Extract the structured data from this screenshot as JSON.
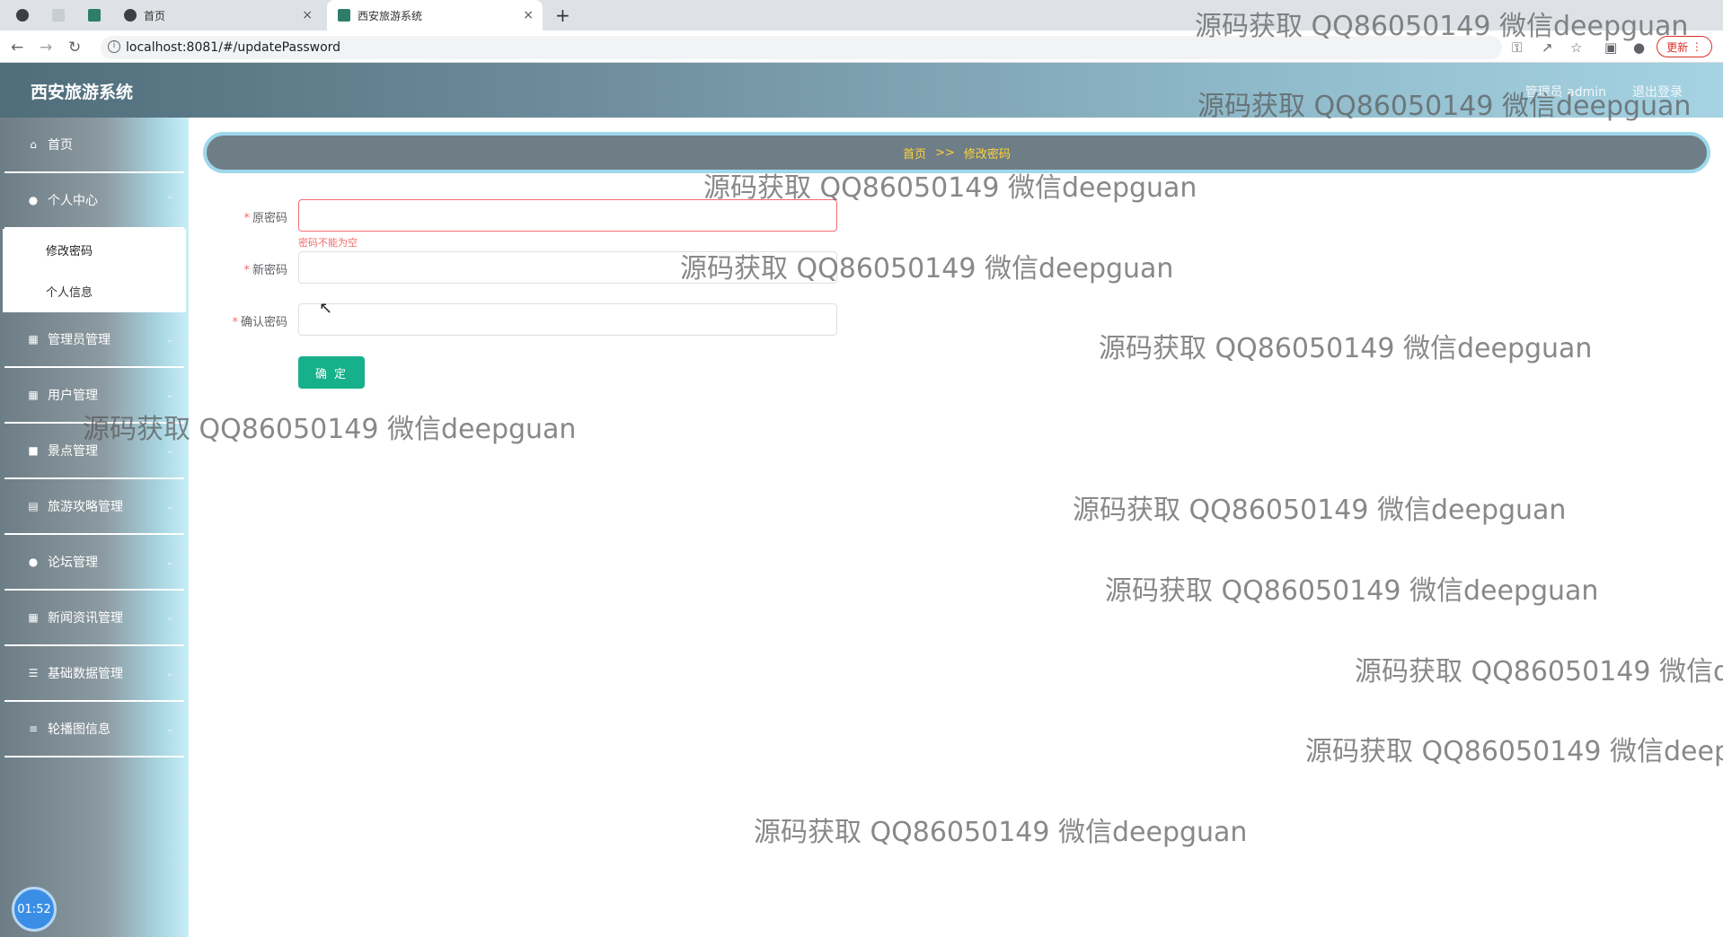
{
  "browser": {
    "tabs": [
      {
        "title": "首页"
      },
      {
        "title": "西安旅游系统"
      }
    ],
    "new_tab": "+",
    "close": "×",
    "url": "localhost:8081/#/updatePassword",
    "update_label": "更新"
  },
  "header": {
    "title": "西安旅游系统",
    "user": "管理员 admin",
    "logout": "退出登录"
  },
  "sidebar": {
    "items": [
      {
        "label": "首页",
        "icon": "home-icon"
      },
      {
        "label": "个人中心",
        "icon": "user-icon"
      },
      {
        "label": "管理员管理",
        "icon": "grid-icon"
      },
      {
        "label": "用户管理",
        "icon": "grid-icon"
      },
      {
        "label": "景点管理",
        "icon": "comment-icon"
      },
      {
        "label": "旅游攻略管理",
        "icon": "document-icon"
      },
      {
        "label": "论坛管理",
        "icon": "user-icon"
      },
      {
        "label": "新闻资讯管理",
        "icon": "grid-icon"
      },
      {
        "label": "基础数据管理",
        "icon": "stack-icon"
      },
      {
        "label": "轮播图信息",
        "icon": "menu-icon"
      }
    ],
    "submenu": [
      {
        "label": "修改密码"
      },
      {
        "label": "个人信息"
      }
    ],
    "clock": "01:52"
  },
  "breadcrumb": {
    "home": "首页",
    "separator": ">>",
    "current": "修改密码"
  },
  "form": {
    "old_password_label": "原密码",
    "new_password_label": "新密码",
    "confirm_password_label": "确认密码",
    "required_mark": "*",
    "error": "密码不能为空",
    "submit": "确 定"
  },
  "watermark": "源码获取 QQ86050149 微信deepguan"
}
